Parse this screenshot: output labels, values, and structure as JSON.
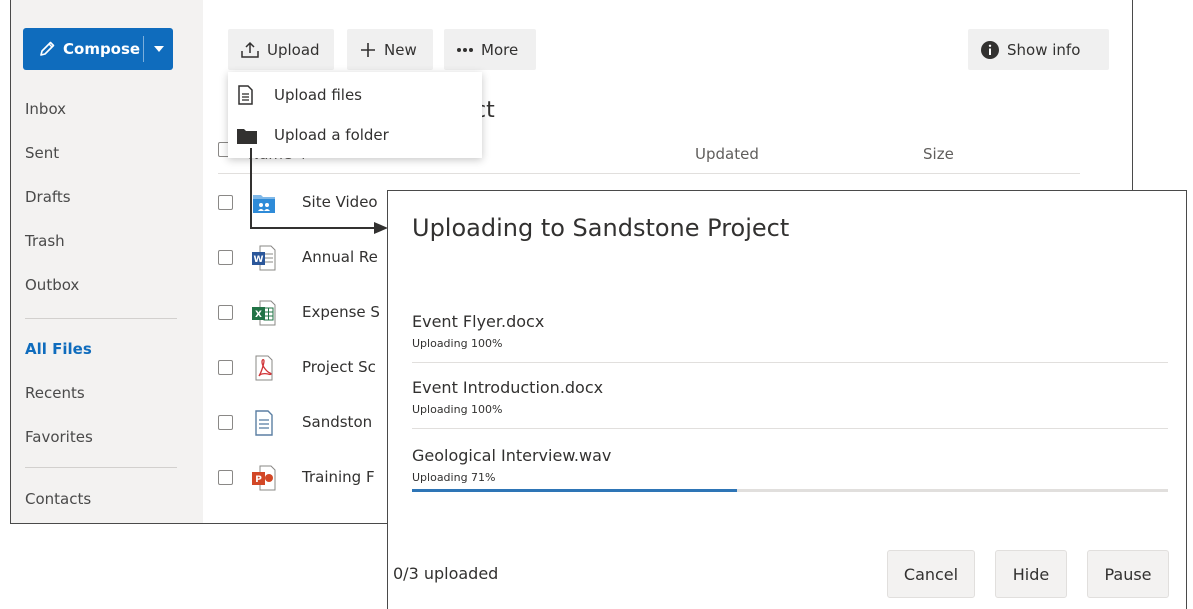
{
  "sidebar": {
    "compose_label": "Compose",
    "items": [
      {
        "label": "Inbox"
      },
      {
        "label": "Sent"
      },
      {
        "label": "Drafts"
      },
      {
        "label": "Trash"
      },
      {
        "label": "Outbox"
      },
      {
        "label": "All Files",
        "active": true
      },
      {
        "label": "Recents"
      },
      {
        "label": "Favorites"
      },
      {
        "label": "Contacts"
      }
    ]
  },
  "toolbar": {
    "upload_label": "Upload",
    "new_label": "New",
    "more_label": "More",
    "show_info_label": "Show info"
  },
  "upload_menu": {
    "items": [
      {
        "label": "Upload files",
        "icon": "document-icon"
      },
      {
        "label": "Upload a folder",
        "icon": "folder-icon"
      }
    ]
  },
  "file_list": {
    "title_visible": "ct",
    "columns": {
      "name": "Name ↑",
      "updated": "Updated",
      "size": "Size"
    },
    "rows": [
      {
        "name": "Site Video",
        "icon": "shared-folder-icon"
      },
      {
        "name": "Annual Re",
        "icon": "word-document-icon"
      },
      {
        "name": "Expense S",
        "icon": "excel-document-icon"
      },
      {
        "name": "Project Sc",
        "icon": "pdf-document-icon"
      },
      {
        "name": "Sandston",
        "icon": "text-document-icon"
      },
      {
        "name": "Training F",
        "icon": "powerpoint-document-icon"
      }
    ]
  },
  "upload_dialog": {
    "title": "Uploading to Sandstone Project",
    "items": [
      {
        "name": "Event Flyer.docx",
        "status": "Uploading 100%",
        "progress": 100
      },
      {
        "name": "Event Introduction.docx",
        "status": "Uploading 100%",
        "progress": 100
      },
      {
        "name": "Geological Interview.wav",
        "status": "Uploading 71%",
        "progress": 43
      }
    ],
    "counter": "0/3 uploaded",
    "buttons": {
      "cancel": "Cancel",
      "hide": "Hide",
      "pause": "Pause"
    }
  },
  "colors": {
    "accent": "#0f6cbd",
    "progress": "#2e75b6"
  }
}
